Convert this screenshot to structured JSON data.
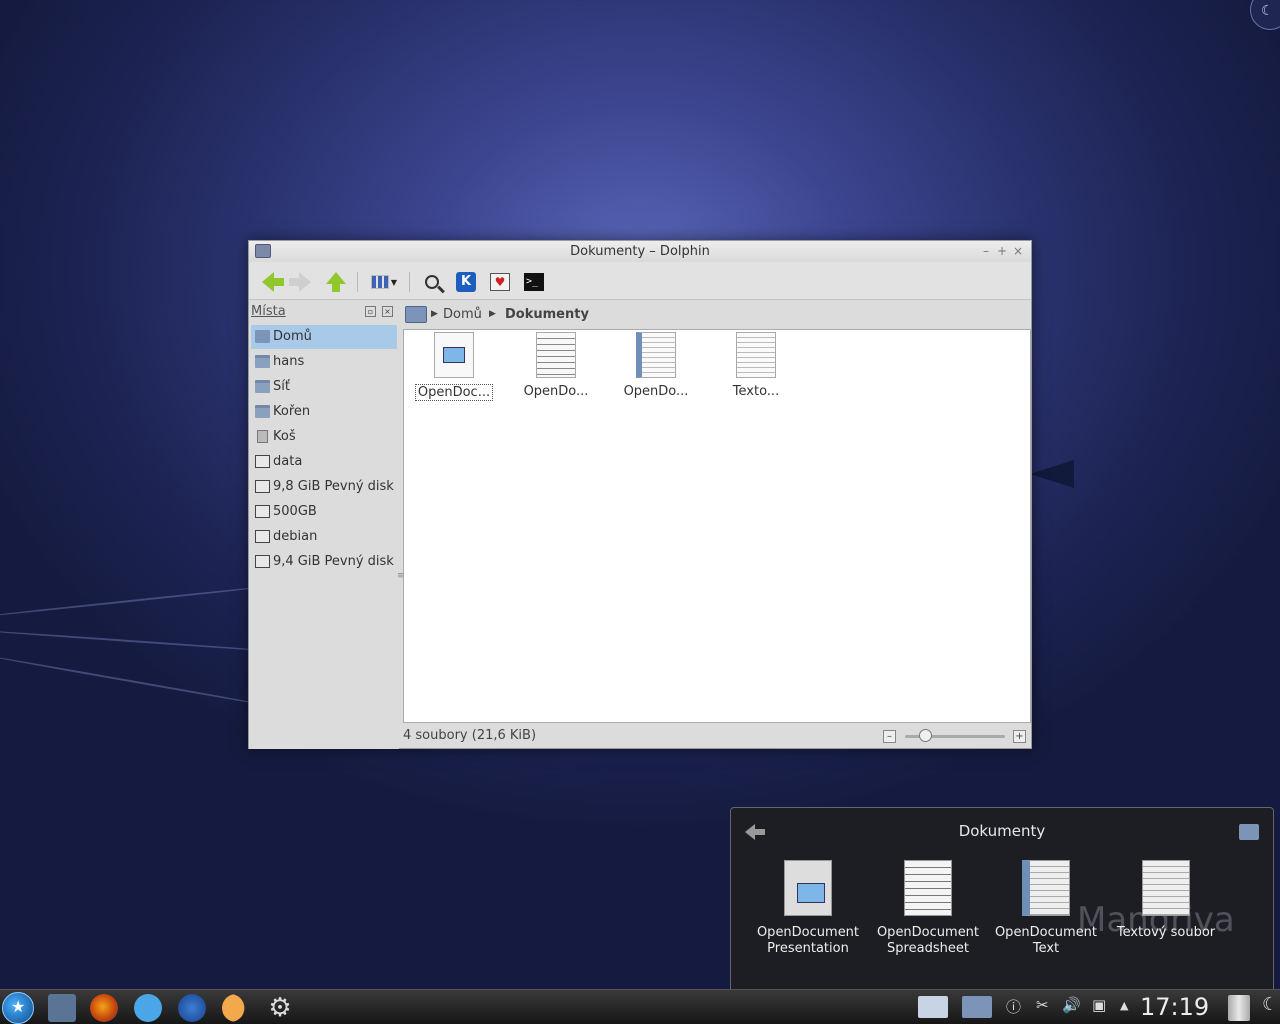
{
  "window": {
    "title": "Dokumenty – Dolphin"
  },
  "places": {
    "header": "Místa",
    "items": [
      {
        "label": "Domů",
        "icon": "home-folder-icon",
        "selected": true
      },
      {
        "label": "hans",
        "icon": "folder-icon"
      },
      {
        "label": "Síť",
        "icon": "network-folder-icon"
      },
      {
        "label": "Kořen",
        "icon": "folder-icon"
      },
      {
        "label": "Koš",
        "icon": "trash-icon"
      },
      {
        "label": "data",
        "icon": "drive-icon"
      },
      {
        "label": "9,8 GiB Pevný disk",
        "icon": "drive-icon"
      },
      {
        "label": "500GB",
        "icon": "drive-icon"
      },
      {
        "label": "debian",
        "icon": "drive-icon"
      },
      {
        "label": "9,4 GiB Pevný disk",
        "icon": "drive-icon"
      }
    ]
  },
  "breadcrumb": {
    "items": [
      "Domů",
      "Dokumenty"
    ]
  },
  "files": [
    {
      "name": "OpenDoc...",
      "type": "presentation"
    },
    {
      "name": "OpenDo...",
      "type": "spreadsheet"
    },
    {
      "name": "OpenDo...",
      "type": "text"
    },
    {
      "name": "Texto...",
      "type": "plain-text"
    }
  ],
  "status": {
    "text": "4 soubory (21,6 KiB)",
    "zoom_level": 0.2
  },
  "popup": {
    "title": "Dokumenty",
    "files": [
      {
        "line1": "OpenDocument",
        "line2": "Presentation"
      },
      {
        "line1": "OpenDocument",
        "line2": "Spreadsheet"
      },
      {
        "line1": "OpenDocument",
        "line2": "Text"
      },
      {
        "line1": "Textový soubor",
        "line2": ""
      }
    ],
    "watermark": "Mandriva"
  },
  "taskbar": {
    "clock": "17:19"
  }
}
